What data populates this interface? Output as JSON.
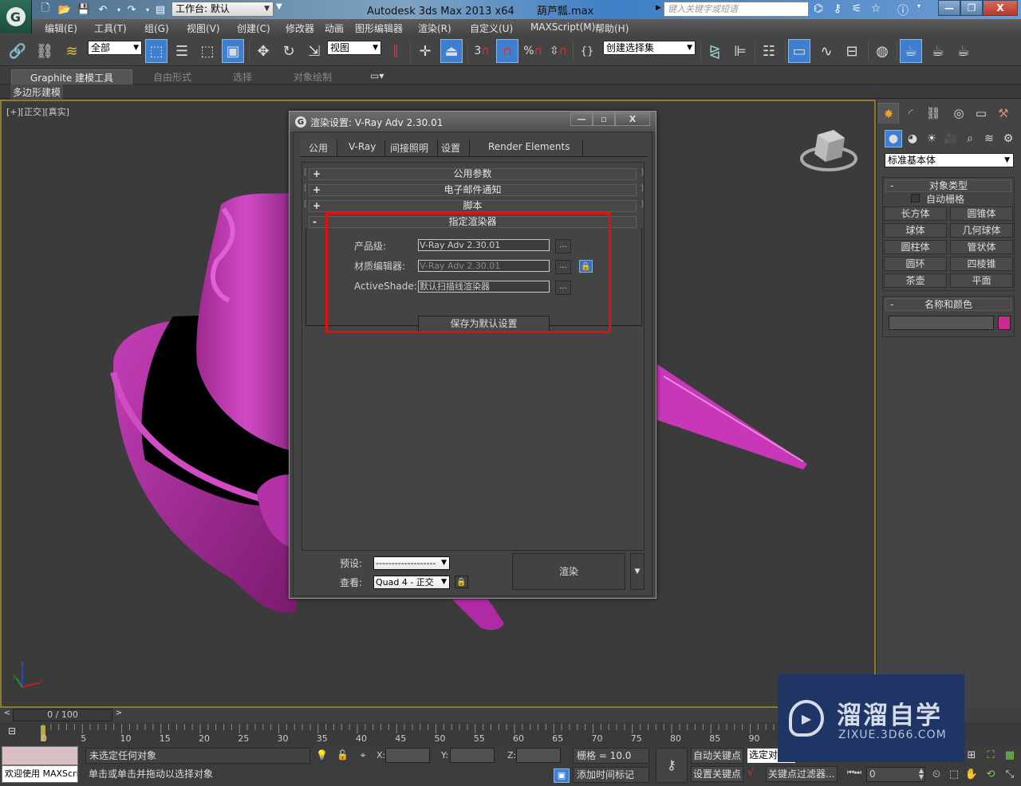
{
  "titlebar": {
    "workspace": "工作台: 默认",
    "app_title": "Autodesk 3ds Max  2013 x64",
    "file_name": "葫芦瓢.max",
    "search_placeholder": "键入关键字或短语"
  },
  "menu": [
    "编辑(E)",
    "工具(T)",
    "组(G)",
    "视图(V)",
    "创建(C)",
    "修改器",
    "动画",
    "图形编辑器",
    "渲染(R)",
    "自定义(U)",
    "MAXScript(M)",
    "帮助(H)"
  ],
  "toolbar": {
    "selection_filter": "全部",
    "ref_coord": "视图",
    "snap_label": "3",
    "named_selection": "创建选择集"
  },
  "ribbon": {
    "tabs": [
      "Graphite 建模工具",
      "自由形式",
      "选择",
      "对象绘制"
    ],
    "panel_label": "多边形建模"
  },
  "viewport": {
    "label": "[+][正交][真实]",
    "object_color": "#c030a8"
  },
  "command_panel": {
    "category": "标准基本体",
    "object_type_title": "对象类型",
    "autogrid": "自动栅格",
    "primitives": [
      "长方体",
      "圆锥体",
      "球体",
      "几何球体",
      "圆柱体",
      "管状体",
      "圆环",
      "四棱锥",
      "茶壶",
      "平面"
    ],
    "name_color_title": "名称和颜色",
    "object_color": "#c82a8e"
  },
  "dialog": {
    "title": "渲染设置: V-Ray Adv 2.30.01",
    "tabs": [
      "公用",
      "V-Ray",
      "间接照明",
      "设置",
      "Render Elements"
    ],
    "rollouts": [
      {
        "sign": "+",
        "label": "公用参数"
      },
      {
        "sign": "+",
        "label": "电子邮件通知"
      },
      {
        "sign": "+",
        "label": "脚本"
      },
      {
        "sign": "-",
        "label": "指定渲染器"
      }
    ],
    "assign": {
      "production_label": "产品级:",
      "production_value": "V-Ray Adv 2.30.01",
      "material_editor_label": "材质编辑器:",
      "material_editor_value": "V-Ray Adv 2.30.01",
      "activeshade_label": "ActiveShade:",
      "activeshade_value": "默认扫描线渲染器",
      "dots": "...",
      "save_default": "保存为默认设置"
    },
    "footer": {
      "preset_label": "预设:",
      "preset_value": "-------------------",
      "view_label": "查看:",
      "view_value": "Quad 4 - 正交",
      "render": "渲染"
    }
  },
  "timeline": {
    "frame_display": "0 / 100",
    "current_frame": 0,
    "total_frames": 100,
    "ticks": [
      "0",
      "5",
      "10",
      "15",
      "20",
      "25",
      "30",
      "35",
      "40",
      "45",
      "50",
      "55",
      "60",
      "65",
      "70",
      "75",
      "80",
      "85",
      "90"
    ]
  },
  "status": {
    "maxscript": "欢迎使用 MAXScri",
    "selection": "未选定任何对象",
    "prompt": "单击或单击并拖动以选择对象",
    "x_label": "X:",
    "y_label": "Y:",
    "z_label": "Z:",
    "grid": "栅格 = 10.0",
    "add_time_tag": "添加时间标记",
    "auto_key": "自动关键点",
    "set_key": "设置关键点",
    "selected": "选定对",
    "key_filters": "关键点过滤器...",
    "frame_value": "0"
  },
  "watermark": {
    "title": "溜溜自学",
    "url": "ZIXUE.3D66.COM"
  },
  "highlight_color": "#e01010"
}
